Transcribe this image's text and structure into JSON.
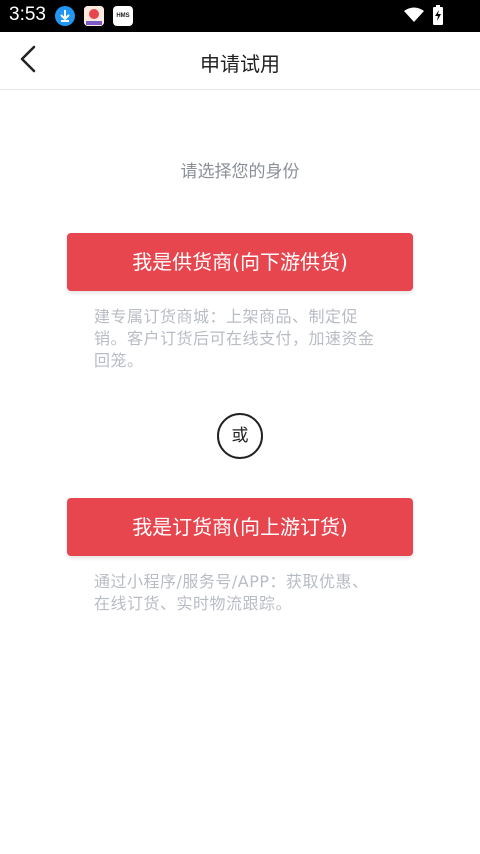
{
  "status_bar": {
    "time": "3:53",
    "hms_label": "HMS",
    "icons": [
      "download-icon",
      "app-notification-icon",
      "hms-icon",
      "wifi-icon",
      "battery-charging-icon"
    ]
  },
  "header": {
    "title": "申请试用",
    "back_icon": "chevron-left-icon"
  },
  "main": {
    "prompt": "请选择您的身份",
    "supplier": {
      "button_label": "我是供货商(向下游供货)",
      "description": "建专属订货商城：上架商品、制定促销。客户订货后可在线支付，加速资金回笼。"
    },
    "divider_label": "或",
    "buyer": {
      "button_label": "我是订货商(向上游订货)",
      "description": "通过小程序/服务号/APP：获取优惠、在线订货、实时物流跟踪。"
    }
  },
  "colors": {
    "accent": "#e8464e",
    "muted_text": "#b8bcc4",
    "prompt_text": "#8a8f99"
  }
}
